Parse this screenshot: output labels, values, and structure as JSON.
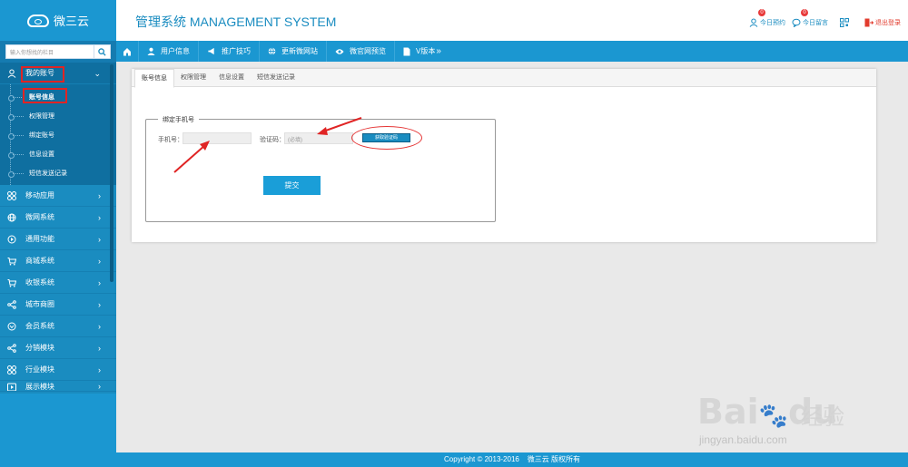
{
  "app": {
    "logo_text": "微三云",
    "title": "管理系统 MANAGEMENT SYSTEM"
  },
  "search": {
    "placeholder": "输入你想找的栏目"
  },
  "header": {
    "appointments_label": "今日预约",
    "appointments_count": "0",
    "messages_label": "今日留言",
    "messages_count": "0",
    "logout_label": "退出登录"
  },
  "sidebar": {
    "account_group": "我的账号",
    "account_items": [
      "账号信息",
      "权限管理",
      "绑定账号",
      "信息设置",
      "短信发送记录"
    ],
    "groups": [
      "移动应用",
      "微网系统",
      "通用功能",
      "商城系统",
      "收银系统",
      "城市商圈",
      "会员系统",
      "分销模块",
      "行业模块",
      "展示模块"
    ]
  },
  "navbar": {
    "items": [
      "用户信息",
      "推广技巧",
      "更新微网站",
      "微官网预览",
      "V版本"
    ]
  },
  "tabs": [
    "账号信息",
    "权限管理",
    "信息设置",
    "短信发送记录"
  ],
  "form": {
    "legend": "绑定手机号",
    "phone_label": "手机号：",
    "phone_value": "",
    "code_label": "验证码：",
    "code_placeholder": "(必填)",
    "get_code_button": "获取验证码",
    "submit_button": "提交"
  },
  "footer": {
    "copyright": "Copyright © 2013-2016",
    "company": "微三云 版权所有"
  },
  "watermark": {
    "brand": "Bai",
    "brand2": "du",
    "cn": "经验",
    "url": "jingyan.baidu.com"
  },
  "colors": {
    "primary": "#1b97d1",
    "sidebar": "#1a8cc0",
    "annotation": "#e02424"
  }
}
